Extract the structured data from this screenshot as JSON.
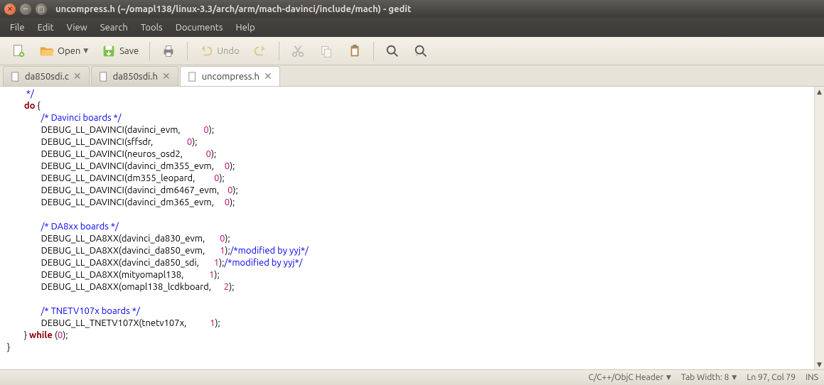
{
  "window": {
    "title": "uncompress.h (~/omapl138/linux-3.3/arch/arm/mach-davinci/include/mach) - gedit"
  },
  "menu": [
    "File",
    "Edit",
    "View",
    "Search",
    "Tools",
    "Documents",
    "Help"
  ],
  "toolbar": {
    "open": "Open",
    "save": "Save",
    "undo": "Undo"
  },
  "tabs": [
    {
      "label": "da850sdi.c",
      "active": false
    },
    {
      "label": "da850sdi.h",
      "active": false
    },
    {
      "label": "uncompress.h",
      "active": true
    }
  ],
  "code": {
    "l0": "         */",
    "l1a": "        ",
    "l1b": "do",
    "l1c": " {",
    "l2a": "                ",
    "l2b": "/* Davinci boards */",
    "l3a": "                DEBUG_LL_DAVINCI(davinci_evm,           ",
    "l3b": "0",
    "l3c": ");",
    "l4a": "                DEBUG_LL_DAVINCI(sffsdr,                ",
    "l4b": "0",
    "l4c": ");",
    "l5a": "                DEBUG_LL_DAVINCI(neuros_osd2,           ",
    "l5b": "0",
    "l5c": ");",
    "l6a": "                DEBUG_LL_DAVINCI(davinci_dm355_evm,     ",
    "l6b": "0",
    "l6c": ");",
    "l7a": "                DEBUG_LL_DAVINCI(dm355_leopard,         ",
    "l7b": "0",
    "l7c": ");",
    "l8a": "                DEBUG_LL_DAVINCI(davinci_dm6467_evm,    ",
    "l8b": "0",
    "l8c": ");",
    "l9a": "                DEBUG_LL_DAVINCI(davinci_dm365_evm,     ",
    "l9b": "0",
    "l9c": ");",
    "l10": " ",
    "l11a": "                ",
    "l11b": "/* DA8xx boards */",
    "l12a": "                DEBUG_LL_DA8XX(davinci_da830_evm,       ",
    "l12b": "0",
    "l12c": ");",
    "l13a": "                DEBUG_LL_DA8XX(davinci_da850_evm,       ",
    "l13b": "1",
    "l13c": ");",
    "l13d": "/*modified by yyj*/",
    "l14a": "                DEBUG_LL_DA8XX(davinci_da850_sdi,       ",
    "l14b": "1",
    "l14c": ");",
    "l14d": "/*modified by yyj*/",
    "l15a": "                DEBUG_LL_DA8XX(mityomapl138,            ",
    "l15b": "1",
    "l15c": ");",
    "l16a": "                DEBUG_LL_DA8XX(omapl138_lcdkboard,      ",
    "l16b": "2",
    "l16c": ");",
    "l17": " ",
    "l18a": "                ",
    "l18b": "/* TNETV107x boards */",
    "l19a": "                DEBUG_LL_TNETV107X(tnetv107x,           ",
    "l19b": "1",
    "l19c": ");",
    "l20a": "        } ",
    "l20b": "while",
    "l20c": " (",
    "l20d": "0",
    "l20e": ");",
    "l21": "}"
  },
  "status": {
    "lang": "C/C++/ObjC Header",
    "tabw": "Tab Width:  8",
    "pos": "Ln 97, Col 79",
    "ins": "INS"
  }
}
